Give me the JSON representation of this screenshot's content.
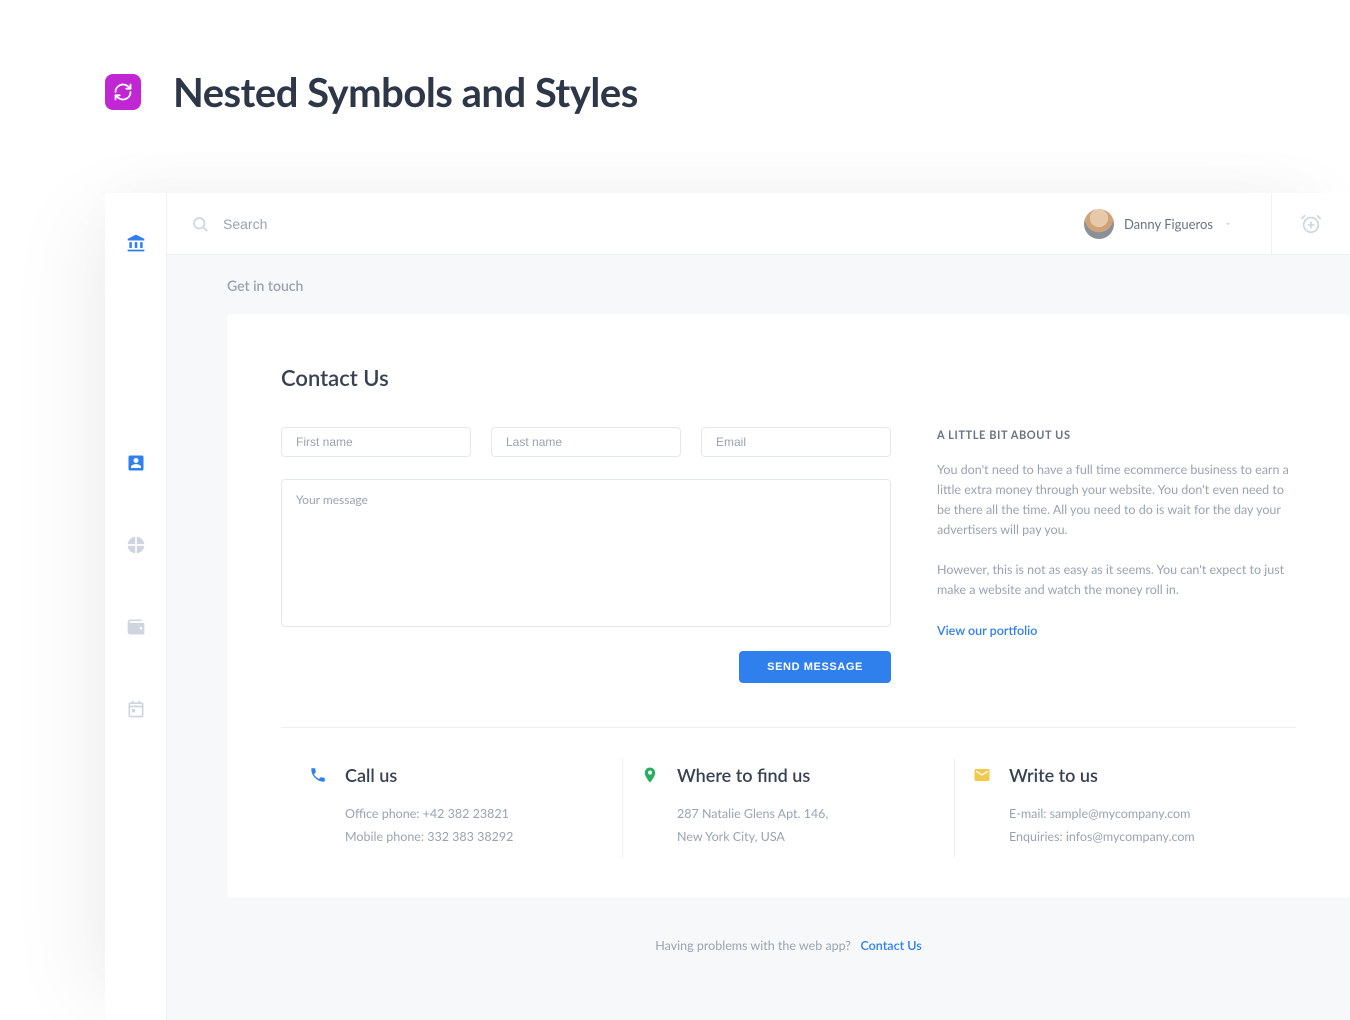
{
  "page": {
    "title": "Nested Symbols and Styles"
  },
  "topbar": {
    "search_placeholder": "Search",
    "user_name": "Danny Figueros"
  },
  "breadcrumb": "Get in touch",
  "card": {
    "title": "Contact Us"
  },
  "form": {
    "first_name_placeholder": "First name",
    "last_name_placeholder": "Last name",
    "email_placeholder": "Email",
    "message_placeholder": "Your message",
    "send_label": "SEND MESSAGE"
  },
  "about": {
    "heading": "A LITTLE BIT ABOUT US",
    "p1": "You don't need to have a full time ecommerce business to earn a little extra money through your website. You don't even need to be there all the time. All you need to do is wait for the day your advertisers will pay you.",
    "p2": "However, this is not as easy as it seems. You can't expect to just make a website and watch the money roll in.",
    "link_label": "View our portfolio"
  },
  "contacts": {
    "call": {
      "title": "Call us",
      "line1": "Office phone: +42 382 23821",
      "line2": "Mobile phone: 332 383 38292"
    },
    "find": {
      "title": "Where to find us",
      "line1": "287 Natalie Glens Apt. 146,",
      "line2": "New York City, USA"
    },
    "write": {
      "title": "Write to us",
      "line1": "E-mail: sample@mycompany.com",
      "line2": "Enquiries: infos@mycompany.com"
    }
  },
  "footer": {
    "text": "Having problems with the web app?",
    "link": "Contact Us"
  },
  "colors": {
    "accent": "#2f80ed",
    "green": "#27ae60",
    "yellow": "#f2c94c",
    "badge": "#c026d3"
  }
}
